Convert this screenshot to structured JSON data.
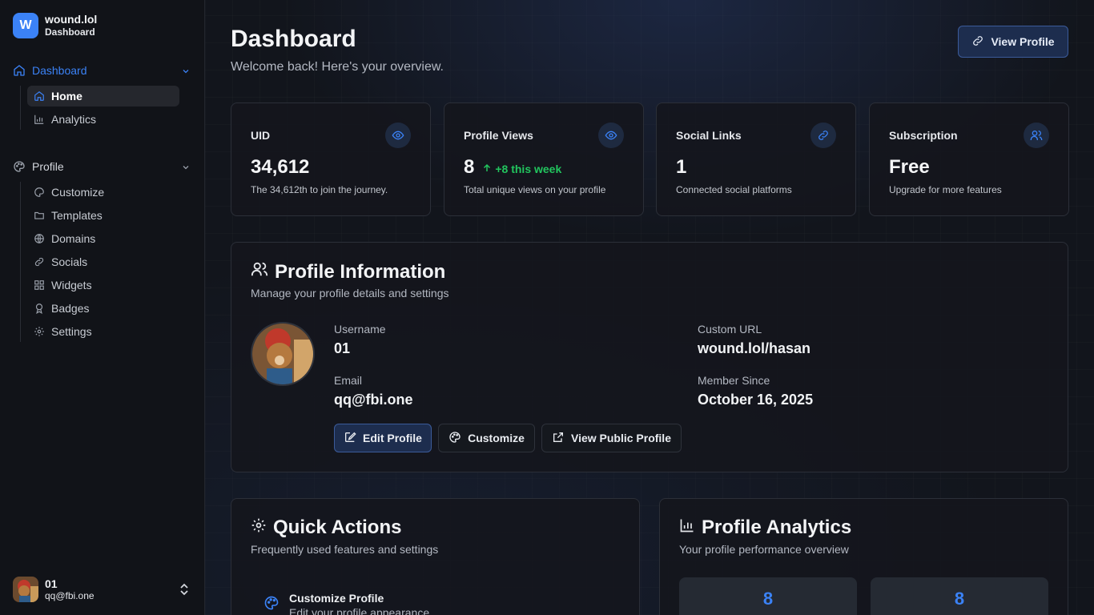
{
  "brand": {
    "logo_letter": "W",
    "name": "wound.lol",
    "subtitle": "Dashboard"
  },
  "sidebar": {
    "groups": [
      {
        "label": "Dashboard",
        "items": [
          {
            "label": "Home"
          },
          {
            "label": "Analytics"
          }
        ]
      },
      {
        "label": "Profile",
        "items": [
          {
            "label": "Customize"
          },
          {
            "label": "Templates"
          },
          {
            "label": "Domains"
          },
          {
            "label": "Socials"
          },
          {
            "label": "Widgets"
          },
          {
            "label": "Badges"
          },
          {
            "label": "Settings"
          }
        ]
      }
    ]
  },
  "user": {
    "name": "01",
    "email": "qq@fbi.one"
  },
  "header": {
    "title": "Dashboard",
    "subtitle": "Welcome back! Here's your overview.",
    "view_profile": "View Profile"
  },
  "stats": [
    {
      "label": "UID",
      "value": "34,612",
      "desc": "The 34,612th to join the journey."
    },
    {
      "label": "Profile Views",
      "value": "8",
      "trend": "+8 this week",
      "desc": "Total unique views on your profile"
    },
    {
      "label": "Social Links",
      "value": "1",
      "desc": "Connected social platforms"
    },
    {
      "label": "Subscription",
      "value": "Free",
      "desc": "Upgrade for more features"
    }
  ],
  "profile": {
    "title": "Profile Information",
    "subtitle": "Manage your profile details and settings",
    "username_label": "Username",
    "username": "01",
    "email_label": "Email",
    "email": "qq@fbi.one",
    "url_label": "Custom URL",
    "url": "wound.lol/hasan",
    "since_label": "Member Since",
    "since": "October 16, 2025",
    "edit_btn": "Edit Profile",
    "customize_btn": "Customize",
    "public_btn": "View Public Profile"
  },
  "quick_actions": {
    "title": "Quick Actions",
    "subtitle": "Frequently used features and settings",
    "items": [
      {
        "title": "Customize Profile",
        "desc": "Edit your profile appearance"
      }
    ]
  },
  "analytics": {
    "title": "Profile Analytics",
    "subtitle": "Your profile performance overview",
    "values": [
      "8",
      "8"
    ]
  },
  "colors": {
    "accent": "#3b82f6",
    "success": "#22c55e",
    "background": "#12151c"
  }
}
